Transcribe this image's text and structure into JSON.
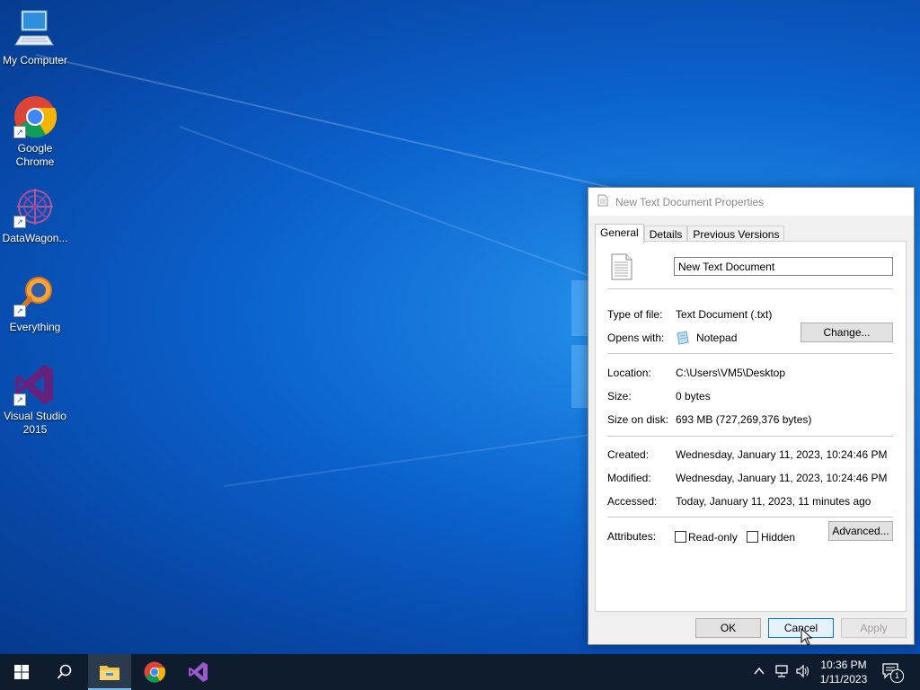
{
  "desktop": {
    "icons": [
      {
        "label": "My Computer",
        "icon": "computer-icon",
        "shortcut": false
      },
      {
        "label": "Google Chrome",
        "icon": "chrome-icon",
        "shortcut": true
      },
      {
        "label": "DataWagon...",
        "icon": "datawagon-icon",
        "shortcut": true
      },
      {
        "label": "Everything",
        "icon": "everything-search-icon",
        "shortcut": true
      },
      {
        "label": "Visual Studio 2015",
        "icon": "visual-studio-icon",
        "shortcut": true
      }
    ]
  },
  "dialog": {
    "title": "New Text Document Properties",
    "tabs": [
      {
        "label": "General",
        "active": true
      },
      {
        "label": "Details",
        "active": false
      },
      {
        "label": "Previous Versions",
        "active": false
      }
    ],
    "file_name": "New Text Document",
    "type_of_file_label": "Type of file:",
    "type_of_file_value": "Text Document (.txt)",
    "opens_with_label": "Opens with:",
    "opens_with_value": "Notepad",
    "change_button": "Change...",
    "location_label": "Location:",
    "location_value": "C:\\Users\\VM5\\Desktop",
    "size_label": "Size:",
    "size_value": "0 bytes",
    "size_on_disk_label": "Size on disk:",
    "size_on_disk_value": "693 MB (727,269,376 bytes)",
    "created_label": "Created:",
    "created_value": "Wednesday, January 11, 2023, 10:24:46 PM",
    "modified_label": "Modified:",
    "modified_value": "Wednesday, January 11, 2023, 10:24:46 PM",
    "accessed_label": "Accessed:",
    "accessed_value": "Today, January 11, 2023, 11 minutes ago",
    "attributes_label": "Attributes:",
    "readonly_label": "Read-only",
    "readonly_checked": false,
    "hidden_label": "Hidden",
    "hidden_checked": false,
    "advanced_button": "Advanced...",
    "ok_button": "OK",
    "cancel_button": "Cancel",
    "apply_button": "Apply"
  },
  "taskbar": {
    "clock_time": "10:36 PM",
    "clock_date": "1/11/2023",
    "notification_count": "1",
    "items": [
      "start-icon",
      "search-icon",
      "file-explorer-icon",
      "chrome-icon",
      "visual-studio-icon"
    ]
  },
  "colors": {
    "accent": "#0078d7",
    "taskbar": "#0f1c2e",
    "dialog_bg": "#f0f0f0"
  }
}
